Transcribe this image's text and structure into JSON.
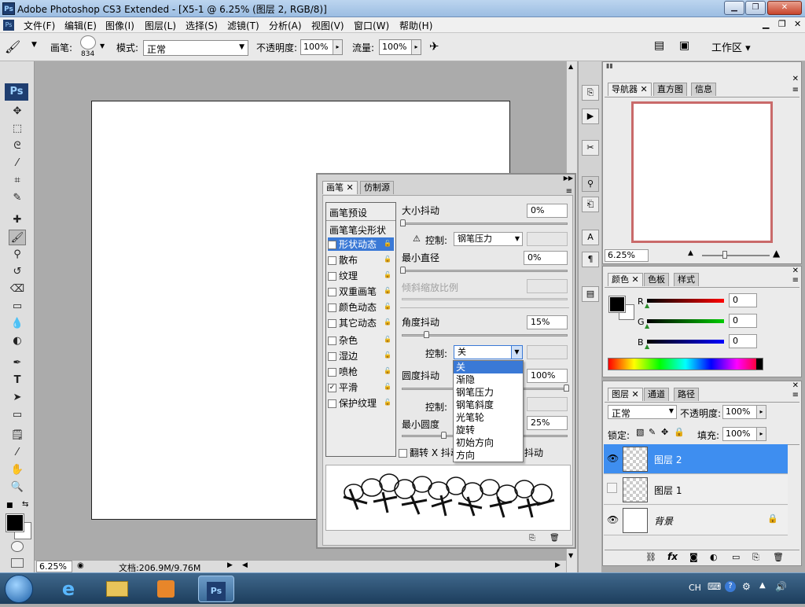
{
  "titlebar": {
    "logo": "Ps",
    "title": "Adobe Photoshop CS3 Extended - [X5-1 @ 6.25% (图层 2, RGB/8)]"
  },
  "menubar": {
    "items": [
      "文件(F)",
      "编辑(E)",
      "图像(I)",
      "图层(L)",
      "选择(S)",
      "滤镜(T)",
      "分析(A)",
      "视图(V)",
      "窗口(W)",
      "帮助(H)"
    ]
  },
  "options": {
    "brush_label": "画笔:",
    "brush_size": "834",
    "mode_label": "模式:",
    "mode_value": "正常",
    "opacity_label": "不透明度:",
    "opacity_value": "100%",
    "flow_label": "流量:",
    "flow_value": "100%",
    "workspace_label": "工作区 ▾"
  },
  "toolbox": {
    "logo": "Ps"
  },
  "status": {
    "zoom": "6.25%",
    "doc": "文档:206.9M/9.76M"
  },
  "brush_panel": {
    "tabs": [
      "画笔",
      "仿制源"
    ],
    "presets_label": "画笔预设",
    "tip_shape_label": "画笔笔尖形状",
    "options": [
      {
        "label": "形状动态",
        "checked": true,
        "selected": true
      },
      {
        "label": "散布",
        "checked": false
      },
      {
        "label": "纹理",
        "checked": false
      },
      {
        "label": "双重画笔",
        "checked": false
      },
      {
        "label": "颜色动态",
        "checked": false
      },
      {
        "label": "其它动态",
        "checked": false
      },
      {
        "label": "杂色",
        "checked": false
      },
      {
        "label": "湿边",
        "checked": false
      },
      {
        "label": "喷枪",
        "checked": false
      },
      {
        "label": "平滑",
        "checked": true
      },
      {
        "label": "保护纹理",
        "checked": false
      }
    ],
    "size_jitter_label": "大小抖动",
    "size_jitter_value": "0%",
    "control_label": "控制:",
    "control1_value": "钢笔压力",
    "min_diameter_label": "最小直径",
    "min_diameter_value": "0%",
    "tilt_scale_label": "倾斜缩放比例",
    "angle_jitter_label": "角度抖动",
    "angle_jitter_value": "15%",
    "control2_value": "关",
    "roundness_jitter_label": "圆度抖动",
    "roundness_jitter_value": "100%",
    "min_roundness_label": "最小圆度",
    "min_roundness_value": "25%",
    "flip_x_label": "翻转 X 抖动",
    "flip_y_label": "抖动",
    "dropdown_options": [
      "关",
      "渐隐",
      "钢笔压力",
      "钢笔斜度",
      "光笔轮",
      "旋转",
      "初始方向",
      "方向"
    ]
  },
  "navigator": {
    "tabs": [
      "导航器",
      "直方图",
      "信息"
    ],
    "zoom": "6.25%"
  },
  "color_panel": {
    "tabs": [
      "颜色",
      "色板",
      "样式"
    ],
    "channels": [
      {
        "name": "R",
        "value": "0"
      },
      {
        "name": "G",
        "value": "0"
      },
      {
        "name": "B",
        "value": "0"
      }
    ]
  },
  "layers_panel": {
    "tabs": [
      "图层",
      "通道",
      "路径"
    ],
    "blend_mode": "正常",
    "opacity_label": "不透明度:",
    "opacity_value": "100%",
    "lock_label": "锁定:",
    "fill_label": "填充:",
    "fill_value": "100%",
    "layers": [
      {
        "name": "图层 2",
        "visible": true,
        "selected": true
      },
      {
        "name": "图层 1",
        "visible": false,
        "selected": false
      },
      {
        "name": "背景",
        "visible": true,
        "selected": false,
        "locked": true
      }
    ]
  },
  "taskbar": {
    "lang": "CH"
  },
  "colors": {
    "accent": "#3a79d6",
    "selected_layer": "#3e8ef0",
    "nav_frame": "#c96a6a"
  }
}
